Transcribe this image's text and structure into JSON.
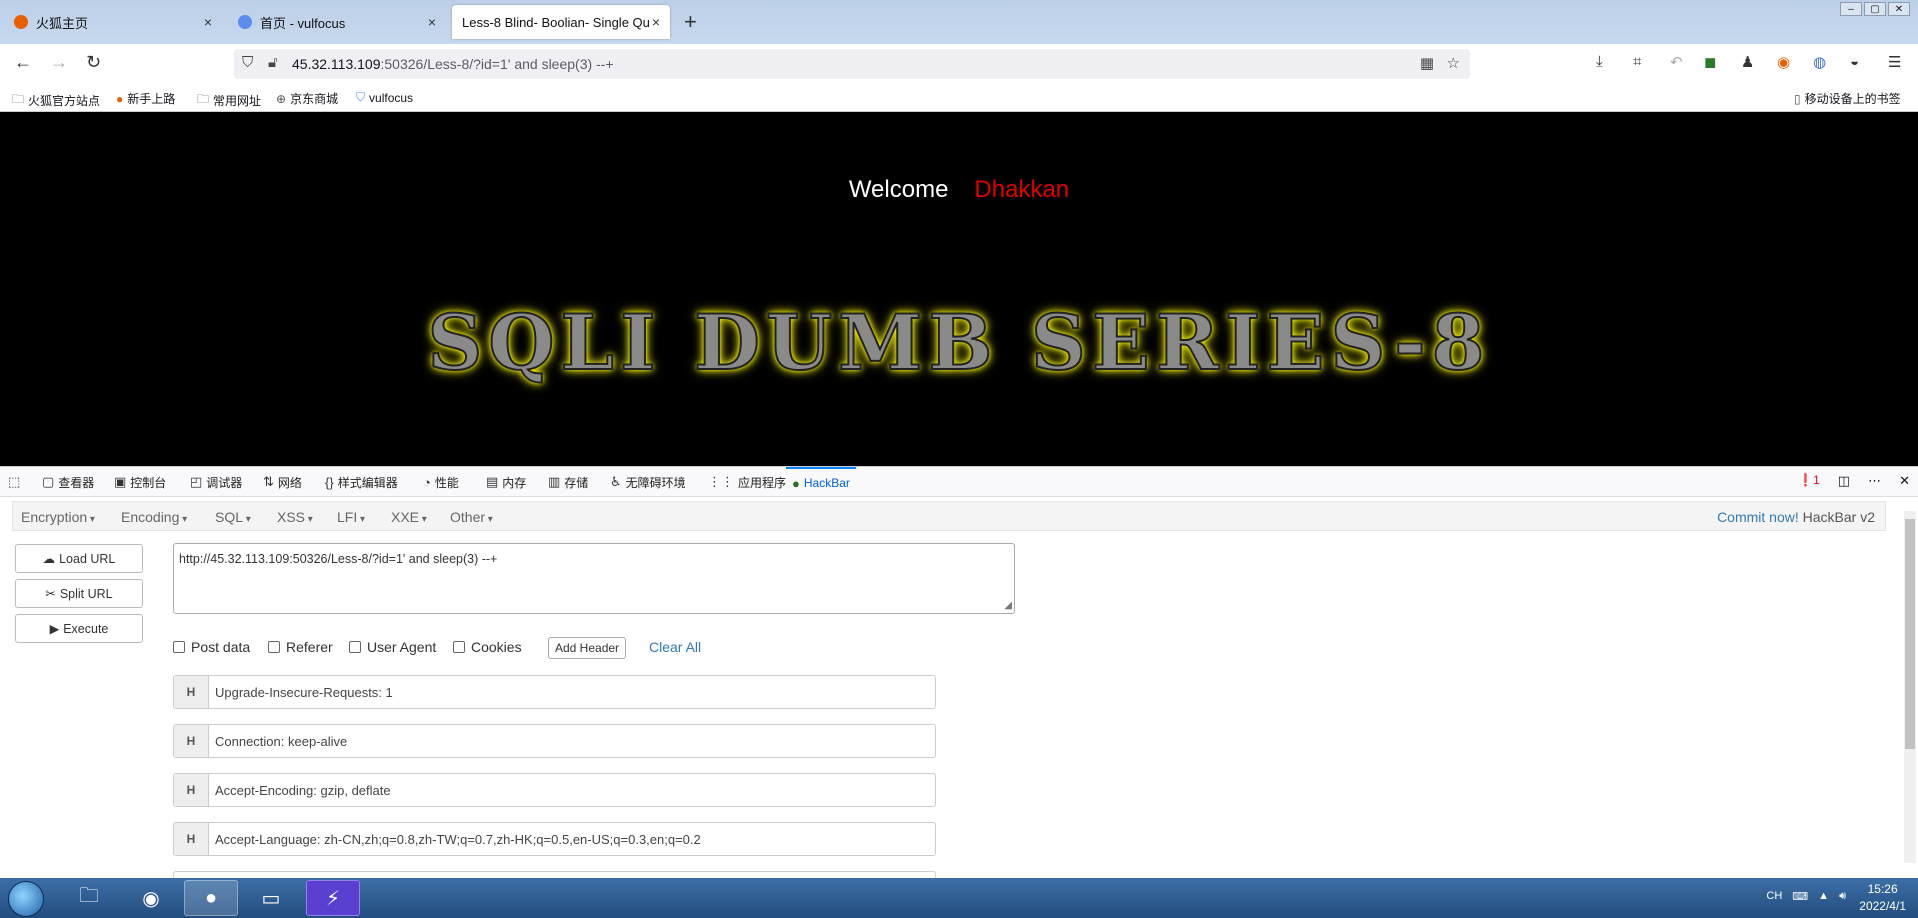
{
  "tabs": [
    {
      "title": "火狐主页",
      "close": "×",
      "active": false,
      "favicon_color": "#e66000"
    },
    {
      "title": "首页 - vulfocus",
      "close": "×",
      "active": false,
      "favicon_color": "#5b8def"
    },
    {
      "title": "Less-8 Blind- Boolian- Single Qu",
      "close": "×",
      "active": true,
      "favicon_color": ""
    }
  ],
  "new_tab": "+",
  "url": {
    "host": "45.32.113.109",
    "rest": ":50326/Less-8/?id=1' and sleep(3) --+"
  },
  "bookmarks": [
    {
      "label": "火狐官方站点",
      "icon": "folder-icon"
    },
    {
      "label": "新手上路",
      "icon": "firefox-icon"
    },
    {
      "label": "常用网址",
      "icon": "folder-icon"
    },
    {
      "label": "京东商城",
      "icon": "globe-icon"
    },
    {
      "label": "vulfocus",
      "icon": "shield-icon"
    }
  ],
  "mobile_bookmarks": "移动设备上的书签",
  "page": {
    "welcome": "Welcome",
    "name": "Dhakkan",
    "banner": "SQLI DUMB SERIES-8"
  },
  "devtools": {
    "tabs": [
      {
        "label": "查看器",
        "icon": "inspector-icon"
      },
      {
        "label": "控制台",
        "icon": "console-icon"
      },
      {
        "label": "调试器",
        "icon": "debugger-icon"
      },
      {
        "label": "网络",
        "icon": "network-icon"
      },
      {
        "label": "样式编辑器",
        "icon": "style-editor-icon"
      },
      {
        "label": "性能",
        "icon": "performance-icon"
      },
      {
        "label": "内存",
        "icon": "memory-icon"
      },
      {
        "label": "存储",
        "icon": "storage-icon"
      },
      {
        "label": "无障碍环境",
        "icon": "accessibility-icon"
      },
      {
        "label": "应用程序",
        "icon": "application-icon"
      },
      {
        "label": "HackBar",
        "icon": "hackbar-icon"
      }
    ],
    "error_count": "1"
  },
  "hackbar": {
    "menus": [
      "Encryption",
      "Encoding",
      "SQL",
      "XSS",
      "LFI",
      "XXE",
      "Other"
    ],
    "commit_link": "Commit now!",
    "commit_version": "HackBar v2",
    "buttons": {
      "load": "Load URL",
      "split": "Split URL",
      "execute": "Execute"
    },
    "url_value": "http://45.32.113.109:50326/Less-8/?id=1' and sleep(3) --+",
    "checkboxes": [
      "Post data",
      "Referer",
      "User Agent",
      "Cookies"
    ],
    "add_header": "Add Header",
    "clear_all": "Clear All",
    "header_tag": "H",
    "headers": [
      "Upgrade-Insecure-Requests: 1",
      "Connection: keep-alive",
      "Accept-Encoding: gzip, deflate",
      "Accept-Language: zh-CN,zh;q=0.8,zh-TW;q=0.7,zh-HK;q=0.5,en-US;q=0.3,en;q=0.2"
    ]
  },
  "taskbar": {
    "clock_time": "15:26",
    "clock_date": "2022/4/1",
    "lang": "CH"
  }
}
